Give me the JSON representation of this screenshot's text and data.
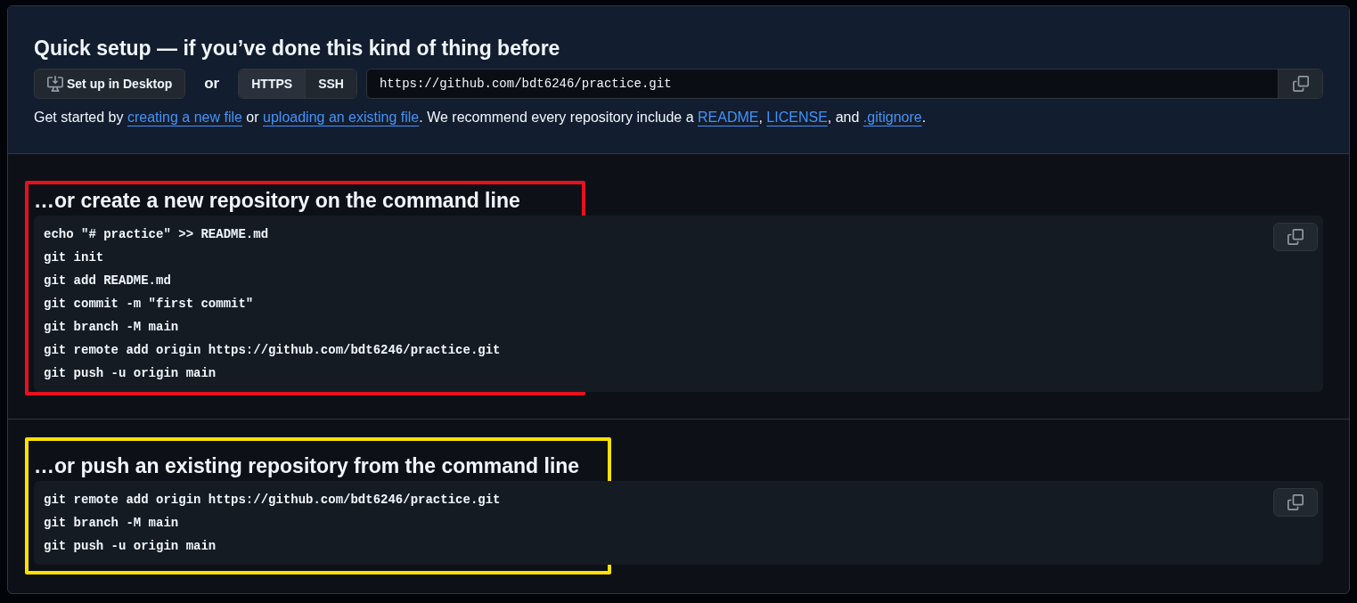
{
  "quick_setup": {
    "title": "Quick setup — if you’ve done this kind of thing before",
    "desktop_button": "Set up in Desktop",
    "or": "or",
    "protocols": [
      {
        "label": "HTTPS",
        "selected": true
      },
      {
        "label": "SSH",
        "selected": false
      }
    ],
    "url": "https://github.com/bdt6246/practice.git",
    "intro": [
      {
        "kind": "text",
        "text": "Get started by "
      },
      {
        "kind": "link",
        "text": "creating a new file"
      },
      {
        "kind": "text",
        "text": " or "
      },
      {
        "kind": "link",
        "text": "uploading an existing file"
      },
      {
        "kind": "text",
        "text": ". We recommend every repository include a "
      },
      {
        "kind": "link",
        "text": "README"
      },
      {
        "kind": "text",
        "text": ", "
      },
      {
        "kind": "link",
        "text": "LICENSE"
      },
      {
        "kind": "text",
        "text": ", and "
      },
      {
        "kind": "link",
        "text": ".gitignore"
      },
      {
        "kind": "text",
        "text": "."
      }
    ]
  },
  "sections": [
    {
      "title": "…or create a new repository on the command line",
      "color": "#e8101e",
      "lines": [
        "echo \"# practice\" >> README.md",
        "git init",
        "git add README.md",
        "git commit -m \"first commit\"",
        "git branch -M main",
        "git remote add origin https://github.com/bdt6246/practice.git",
        "git push -u origin main"
      ]
    },
    {
      "title": "…or push an existing repository from the command line",
      "color": "#ffe000",
      "lines": [
        "git remote add origin https://github.com/bdt6246/practice.git",
        "git branch -M main",
        "git push -u origin main"
      ]
    }
  ]
}
